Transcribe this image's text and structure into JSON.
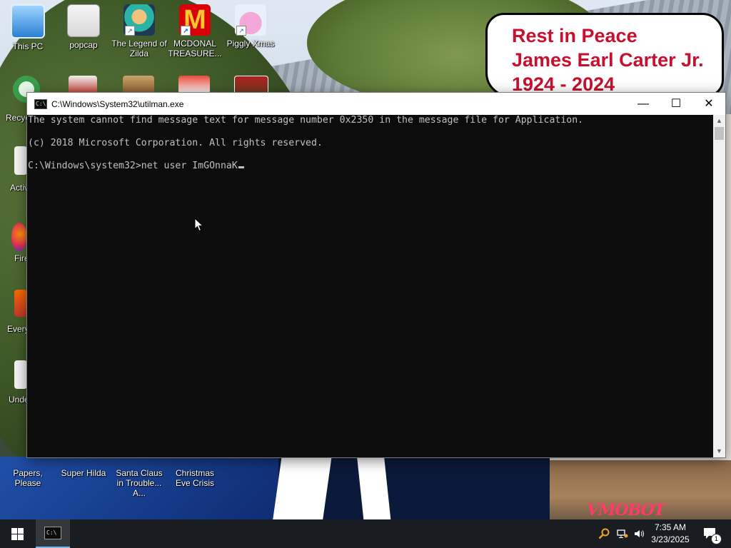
{
  "desktop": {
    "icons_top": [
      {
        "label": "This PC"
      },
      {
        "label": "popcap"
      },
      {
        "label": "The Legend of Zilda"
      },
      {
        "label": "MCDONAL TREASURE..."
      },
      {
        "label": "Piggly Xmas"
      }
    ],
    "icons_bottom": [
      {
        "label": "Papers, Please"
      },
      {
        "label": "Super Hilda"
      },
      {
        "label": "Santa Claus in Trouble... A..."
      },
      {
        "label": "Christmas Eve Crisis"
      }
    ],
    "partial_labels": [
      "Recyc",
      "Activ",
      "Fire",
      "Every",
      "Unde"
    ],
    "memorial": {
      "line1": "Rest in Peace",
      "line2": "James Earl Carter Jr.",
      "line3": "1924 - 2024"
    },
    "watermark": "VMOBOT"
  },
  "cmd_window": {
    "title": "C:\\Windows\\System32\\utilman.exe",
    "buttons": {
      "minimize": "—",
      "maximize": "☐",
      "close": "✕"
    },
    "lines": [
      "The system cannot find message text for message number 0x2350 in the message file for Application.",
      "(c) 2018 Microsoft Corporation. All rights reserved.",
      "C:\\Windows\\system32>net user ImGOnnaK"
    ]
  },
  "taskbar": {
    "time": "7:35 AM",
    "date": "3/23/2025",
    "notification_count": "1",
    "icons": [
      "windows-start-icon",
      "cmd-icon",
      "search-icon",
      "network-icon",
      "volume-icon",
      "notification-icon"
    ]
  }
}
